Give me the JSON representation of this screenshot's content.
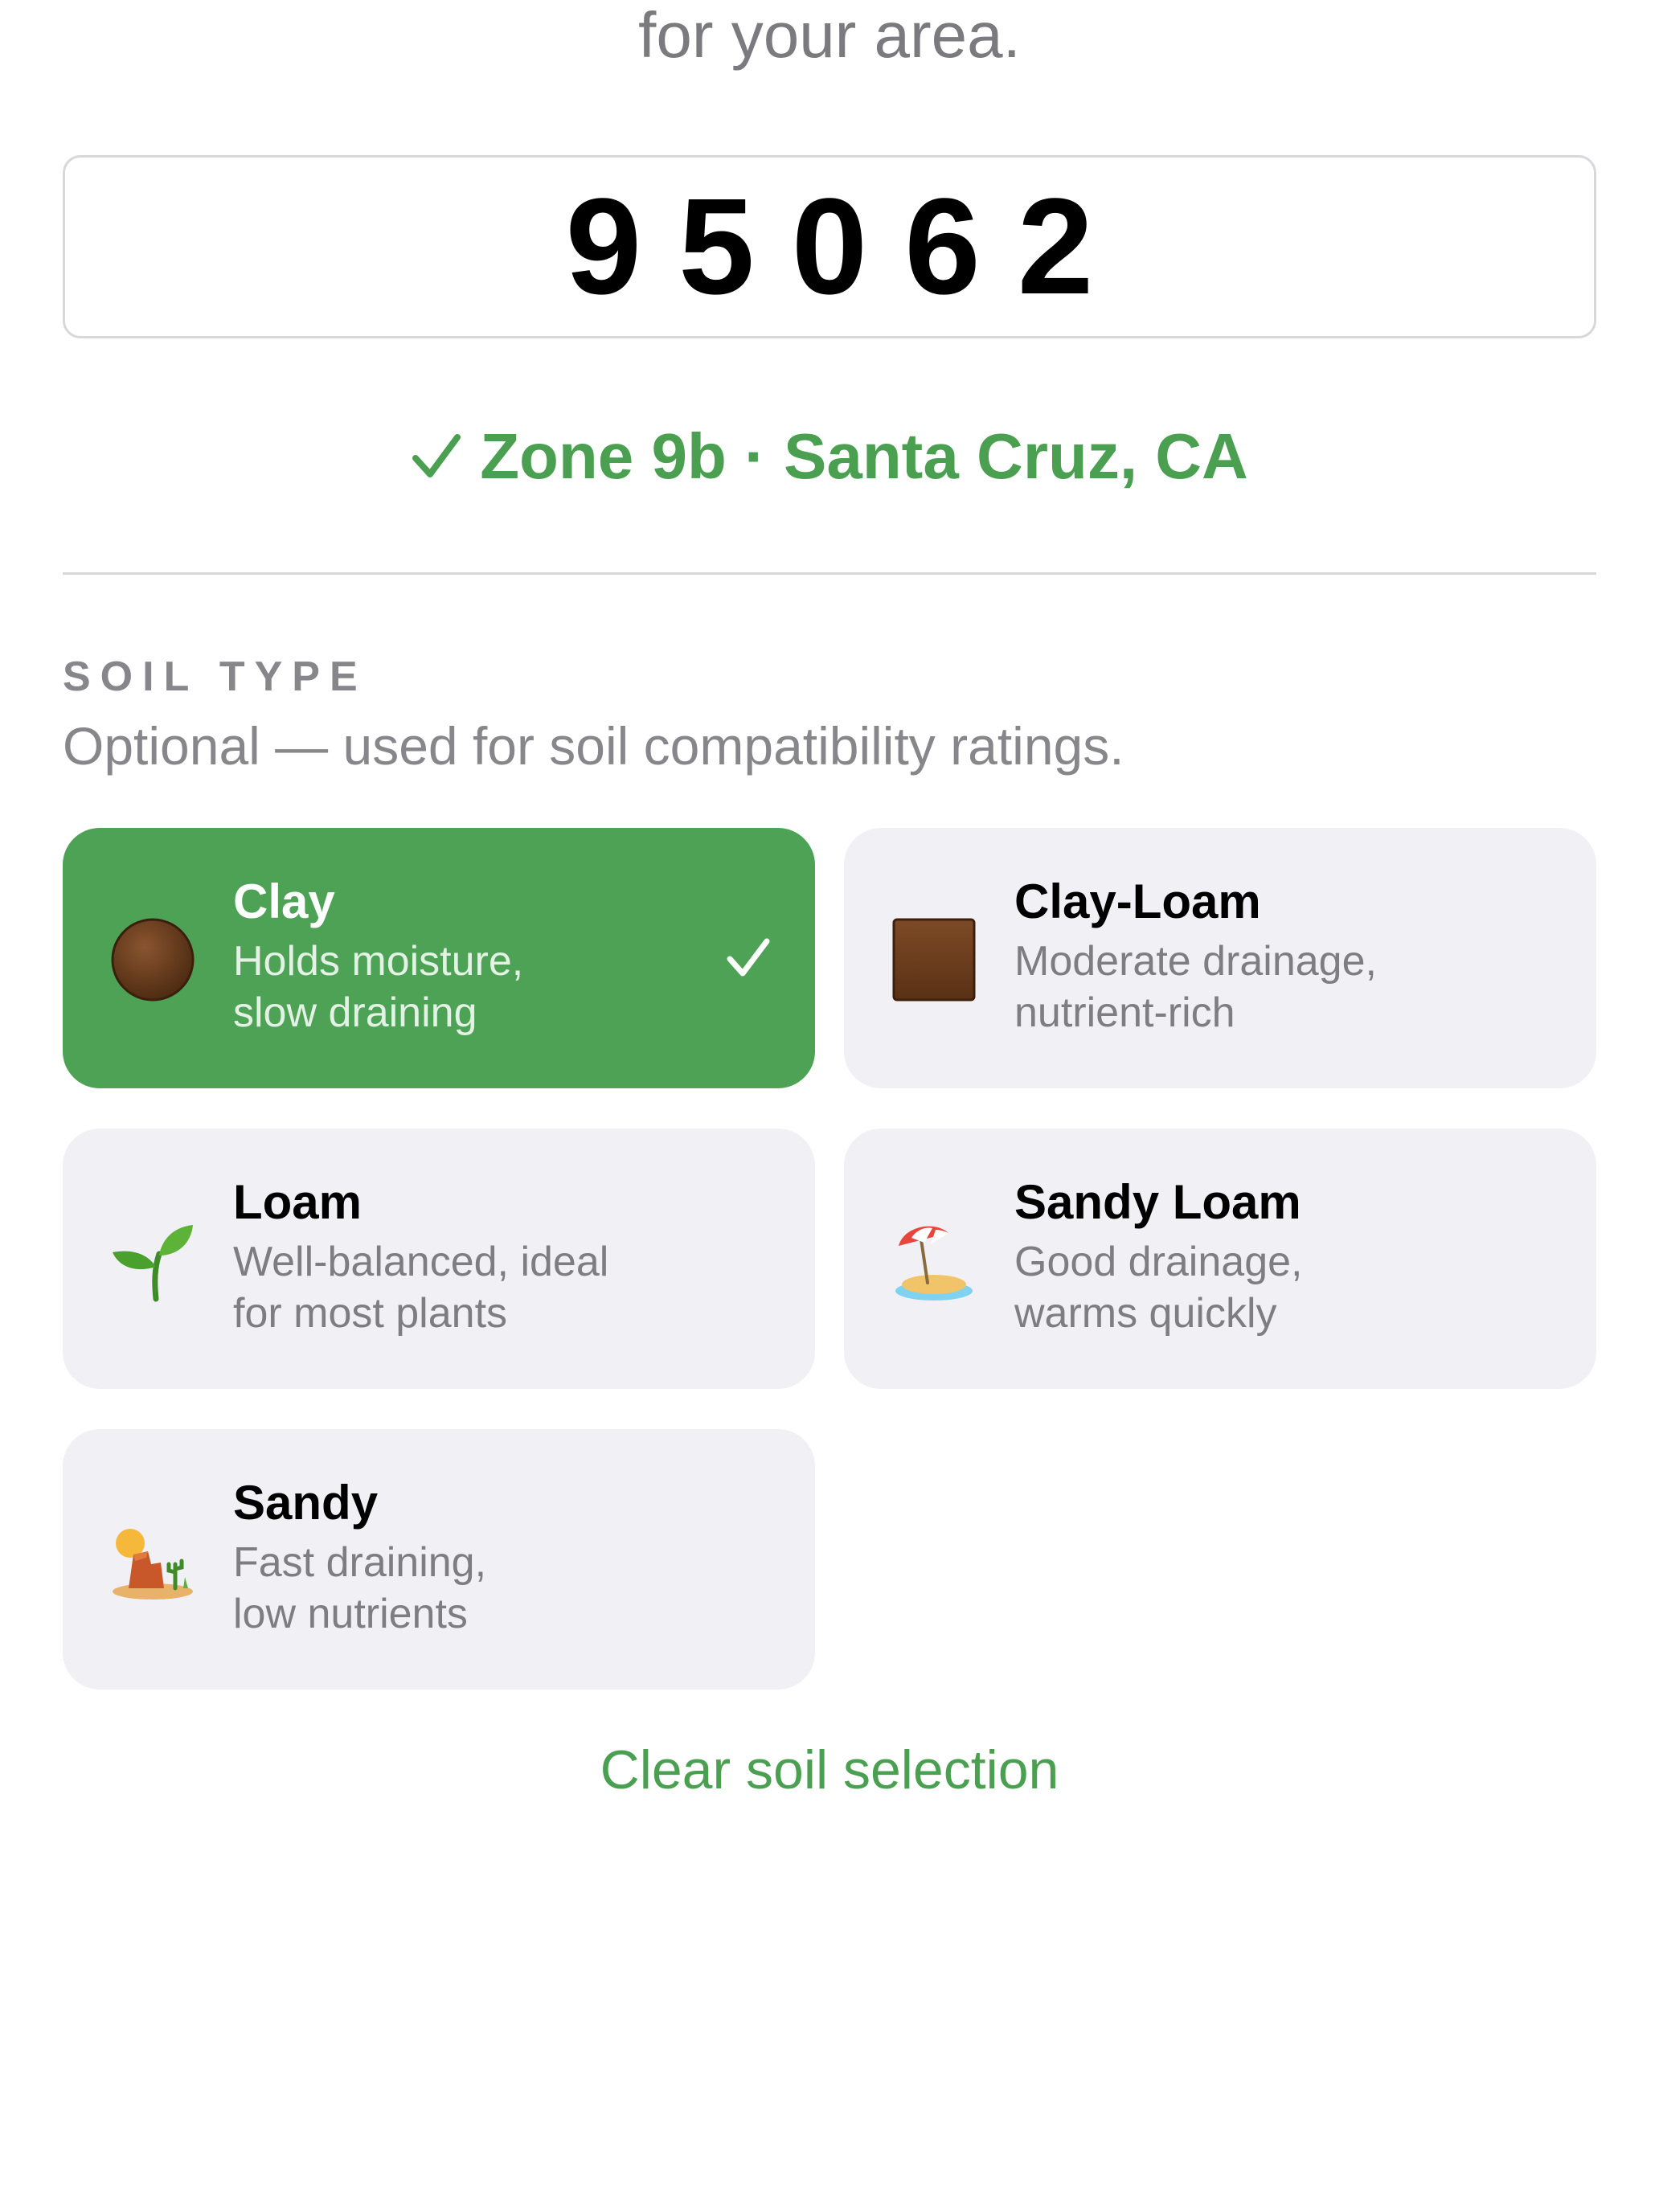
{
  "intro": {
    "tail_text": "for your area."
  },
  "zip": {
    "value": "95062"
  },
  "zone_status": {
    "text": "Zone 9b · Santa Cruz, CA",
    "icon": "check-icon",
    "color": "#4a9f51"
  },
  "soil_section": {
    "label": "SOIL TYPE",
    "help": "Optional — used for soil compatibility ratings.",
    "options": [
      {
        "title": "Clay",
        "desc_line1": "Holds moisture,",
        "desc_line2": "slow draining",
        "icon": "brown-circle-icon",
        "selected": true
      },
      {
        "title": "Clay-Loam",
        "desc_line1": "Moderate drainage,",
        "desc_line2": "nutrient-rich",
        "icon": "brown-square-icon",
        "selected": false
      },
      {
        "title": "Loam",
        "desc_line1": "Well-balanced, ideal",
        "desc_line2": "for most plants",
        "icon": "seedling-icon",
        "selected": false
      },
      {
        "title": "Sandy Loam",
        "desc_line1": "Good drainage,",
        "desc_line2": "warms quickly",
        "icon": "beach-umbrella-icon",
        "selected": false
      },
      {
        "title": "Sandy",
        "desc_line1": "Fast draining,",
        "desc_line2": "low nutrients",
        "icon": "desert-icon",
        "selected": false
      }
    ],
    "clear_label": "Clear soil selection"
  },
  "colors": {
    "accent": "#4ea256",
    "card_bg": "#f1f1f5",
    "muted_text": "#86868b"
  }
}
